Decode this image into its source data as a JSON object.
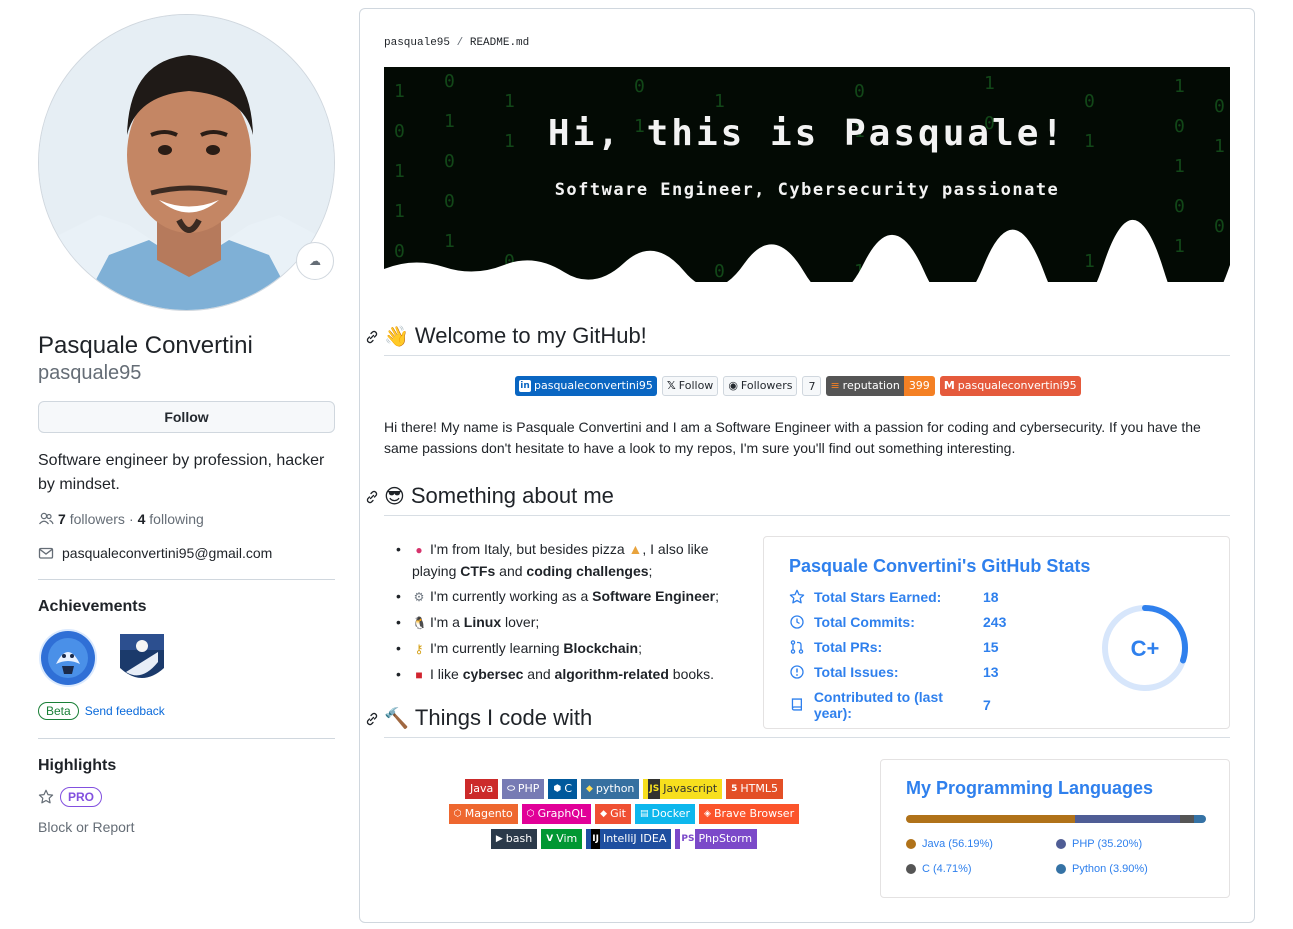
{
  "profile": {
    "name": "Pasquale Convertini",
    "login": "pasquale95",
    "follow_label": "Follow",
    "bio": "Software engineer by profession, hacker by mindset.",
    "followers_count": "7",
    "followers_label": "followers",
    "following_count": "4",
    "following_label": "following",
    "separator": "·",
    "email": "pasqualeconvertini95@gmail.com",
    "achievements_title": "Achievements",
    "beta_label": "Beta",
    "feedback_label": "Send feedback",
    "highlights_title": "Highlights",
    "pro_label": "PRO",
    "block_label": "Block or Report"
  },
  "readme": {
    "crumb_user": "pasquale95",
    "crumb_sep": "/",
    "crumb_file": "README.md",
    "banner_title": "Hi, this is Pasquale!",
    "banner_subtitle": "Software Engineer, Cybersecurity passionate",
    "welcome_heading": "Welcome to my GitHub!",
    "welcome_emoji": "👋",
    "badges": {
      "linkedin": "pasqualeconvertini95",
      "x_follow": "Follow",
      "gh_followers": "Followers",
      "gh_followers_count": "7",
      "reputation_label": "reputation",
      "reputation_value": "399",
      "gmail": "pasqualeconvertini95"
    },
    "intro": "Hi there! My name is Pasquale Convertini and I am a Software Engineer with a passion for coding and cybersecurity. If you have the same passions don't hesitate to have a look to my repos, I'm sure you'll find out something interesting.",
    "about_heading": "Something about me",
    "about_emoji": "😎",
    "about": {
      "i1_a": "I'm from Italy, but besides pizza",
      "i1_b": ", I also like playing",
      "i1_ctf": "CTFs",
      "i1_and": "and",
      "i1_coding": "coding challenges",
      "i1_end": ";",
      "i2_a": "I'm currently working as a",
      "i2_b": "Software Engineer",
      "i2_end": ";",
      "i3_a": "I'm a",
      "i3_b": "Linux",
      "i3_c": "lover;",
      "i4_a": "I'm currently learning",
      "i4_b": "Blockchain",
      "i4_end": ";",
      "i5_a": "I like",
      "i5_b": "cybersec",
      "i5_and": "and",
      "i5_c": "algorithm-related",
      "i5_d": "books."
    },
    "code_heading": "Things I code with",
    "code_emoji": "🔨"
  },
  "stats": {
    "title": "Pasquale Convertini's GitHub Stats",
    "rows": [
      {
        "label": "Total Stars Earned:",
        "value": "18"
      },
      {
        "label": "Total Commits:",
        "value": "243"
      },
      {
        "label": "Total PRs:",
        "value": "15"
      },
      {
        "label": "Total Issues:",
        "value": "13"
      },
      {
        "label": "Contributed to (last year):",
        "value": "7"
      }
    ],
    "rank": "C+",
    "rank_progress": 0.3
  },
  "tech": {
    "row1": [
      "Java",
      "PHP",
      "C",
      "python",
      "Javascript",
      "HTML5"
    ],
    "row2": [
      "Magento",
      "GraphQL",
      "Git",
      "Docker",
      "Brave Browser"
    ],
    "row3": [
      "bash",
      "Vim",
      "IntelliJ IDEA",
      "PhpStorm"
    ]
  },
  "languages": {
    "title": "My Programming Languages",
    "items": [
      {
        "name": "Java",
        "pct": "56.19%",
        "label": "Java (56.19%)",
        "color": "#b07219",
        "value": 56.19
      },
      {
        "name": "PHP",
        "pct": "35.20%",
        "label": "PHP (35.20%)",
        "color": "#4F5D95",
        "value": 35.2
      },
      {
        "name": "C",
        "pct": "4.71%",
        "label": "C (4.71%)",
        "color": "#555555",
        "value": 4.71
      },
      {
        "name": "Python",
        "pct": "3.90%",
        "label": "Python (3.90%)",
        "color": "#3572A5",
        "value": 3.9
      }
    ]
  },
  "colors": {
    "accent": "#2f80ed",
    "link": "#0969da",
    "pro": "#8250df",
    "beta": "#1a7f37"
  }
}
